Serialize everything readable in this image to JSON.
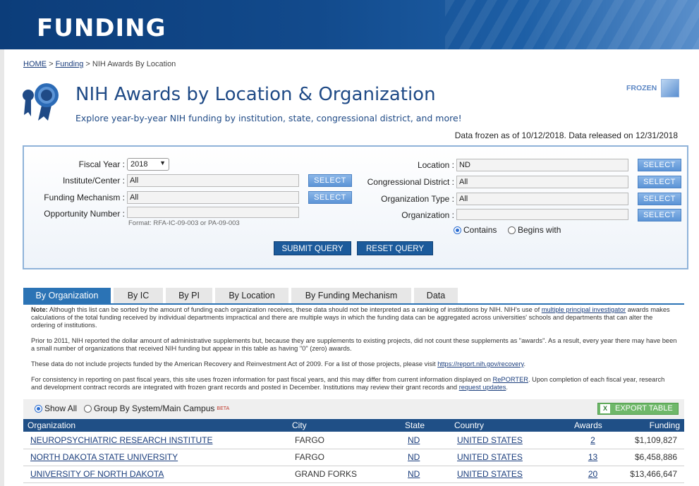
{
  "banner": {
    "title": "FUNDING"
  },
  "breadcrumb": {
    "home": "HOME",
    "sep1": ">",
    "funding": "Funding",
    "sep2": ">",
    "current": "NIH Awards By Location"
  },
  "header": {
    "title": "NIH Awards by Location & Organization",
    "subtitle": "Explore year-by-year NIH funding by institution, state, congressional district, and more!",
    "frozen_label": "FROZEN",
    "data_note": "Data frozen as of 10/12/2018. Data released on 12/31/2018"
  },
  "query": {
    "fiscal_year_label": "Fiscal Year :",
    "fiscal_year_value": "2018",
    "institute_label": "Institute/Center :",
    "institute_value": "All",
    "mechanism_label": "Funding Mechanism :",
    "mechanism_value": "All",
    "opportunity_label": "Opportunity Number :",
    "opportunity_value": "",
    "opportunity_format": "Format: RFA-IC-09-003 or PA-09-003",
    "location_label": "Location :",
    "location_value": "ND",
    "district_label": "Congressional District :",
    "district_value": "All",
    "orgtype_label": "Organization Type :",
    "orgtype_value": "All",
    "organization_label": "Organization :",
    "organization_value": "",
    "select_label": "SELECT",
    "contains_label": "Contains",
    "begins_label": "Begins with",
    "submit_label": "SUBMIT QUERY",
    "reset_label": "RESET QUERY"
  },
  "tabs": [
    "By Organization",
    "By IC",
    "By PI",
    "By Location",
    "By Funding Mechanism",
    "Data"
  ],
  "notes": {
    "n1_bold": "Note:",
    "n1_a": " Although this list can be sorted by the amount of funding each organization receives, these data should not be interpreted as a ranking of institutions by NIH. NIH's use of ",
    "n1_link": "multiple principal investigator",
    "n1_b": " awards makes calculations of the total funding received by individual departments impractical and there are multiple ways in which the funding data can be aggregated across universities' schools and departments that can alter the ordering of institutions.",
    "n2": "Prior to 2011, NIH reported the dollar amount of administrative supplements but, because they are supplements to existing projects, did not count these supplements as \"awards\". As a result, every year there may have been a small number of organizations that received NIH funding but appear in this table as having \"0\" (zero) awards.",
    "n3_a": "These data do not include projects funded by the American Recovery and Reinvestment Act of 2009. For a list of those projects, please visit ",
    "n3_link": "https://report.nih.gov/recovery",
    "n3_b": ".",
    "n4_a": "For consistency in reporting on past fiscal years, this site uses frozen information for past fiscal years, and this may differ from current information displayed on ",
    "n4_link1": "RePORTER",
    "n4_b": ". Upon completion of each fiscal year, research and development contract records are integrated with frozen grant records and posted in December. Institutions may review their grant records and ",
    "n4_link2": "request updates",
    "n4_c": "."
  },
  "options": {
    "show_all": "Show All",
    "group_by": "Group By System/Main Campus",
    "beta": "BETA",
    "export": "EXPORT TABLE",
    "export_icon": "X"
  },
  "table": {
    "headers": [
      "Organization",
      "City",
      "State",
      "Country",
      "Awards",
      "Funding"
    ],
    "rows": [
      {
        "org": "NEUROPSYCHIATRIC RESEARCH INSTITUTE",
        "city": "FARGO",
        "state": "ND",
        "country": "UNITED STATES",
        "awards": "2",
        "funding": "$1,109,827"
      },
      {
        "org": "NORTH DAKOTA STATE UNIVERSITY",
        "city": "FARGO",
        "state": "ND",
        "country": "UNITED STATES",
        "awards": "13",
        "funding": "$6,458,886"
      },
      {
        "org": "UNIVERSITY OF NORTH DAKOTA",
        "city": "GRAND FORKS",
        "state": "ND",
        "country": "UNITED STATES",
        "awards": "20",
        "funding": "$13,466,647"
      }
    ]
  },
  "colors": {
    "banner": "#124a8c",
    "accent": "#2b73b5",
    "header_row": "#1f4f86",
    "export": "#6fb86a"
  }
}
